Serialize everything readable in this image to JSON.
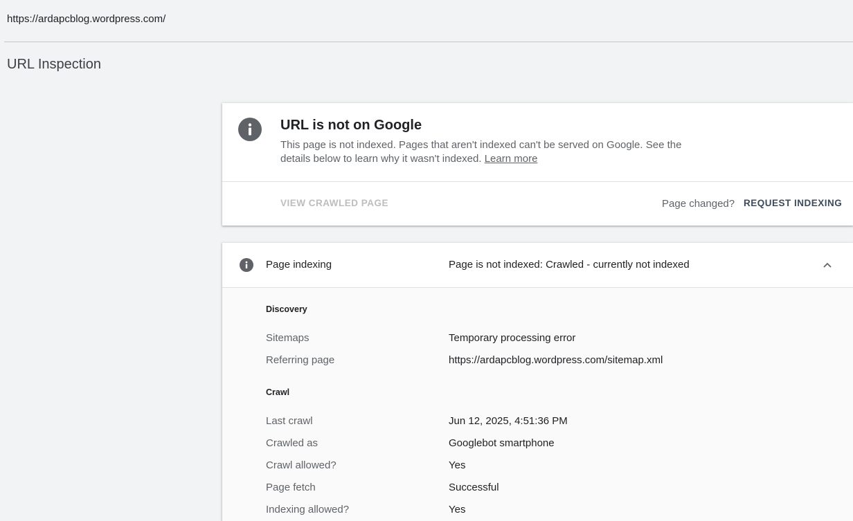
{
  "header": {
    "url": "https://ardapcblog.wordpress.com/"
  },
  "page": {
    "title": "URL Inspection"
  },
  "status": {
    "icon": "info-icon",
    "title": "URL is not on Google",
    "description": "This page is not indexed. Pages that aren't indexed can't be served on Google. See the details below to learn why it wasn't indexed.",
    "learn_more": "Learn more",
    "view_crawled_page": "VIEW CRAWLED PAGE",
    "page_changed": "Page changed?",
    "request_indexing": "REQUEST INDEXING"
  },
  "indexing": {
    "label": "Page indexing",
    "value": "Page is not indexed: Crawled - currently not indexed",
    "discovery": {
      "heading": "Discovery",
      "rows": [
        {
          "label": "Sitemaps",
          "value": "Temporary processing error"
        },
        {
          "label": "Referring page",
          "value": "https://ardapcblog.wordpress.com/sitemap.xml"
        }
      ]
    },
    "crawl": {
      "heading": "Crawl",
      "rows": [
        {
          "label": "Last crawl",
          "value": "Jun 12, 2025, 4:51:36 PM"
        },
        {
          "label": "Crawled as",
          "value": "Googlebot smartphone"
        },
        {
          "label": "Crawl allowed?",
          "value": "Yes"
        },
        {
          "label": "Page fetch",
          "value": "Successful"
        },
        {
          "label": "Indexing allowed?",
          "value": "Yes"
        }
      ]
    }
  },
  "colors": {
    "accent": "#3c4a5c",
    "icon_grey": "#5f6368"
  }
}
